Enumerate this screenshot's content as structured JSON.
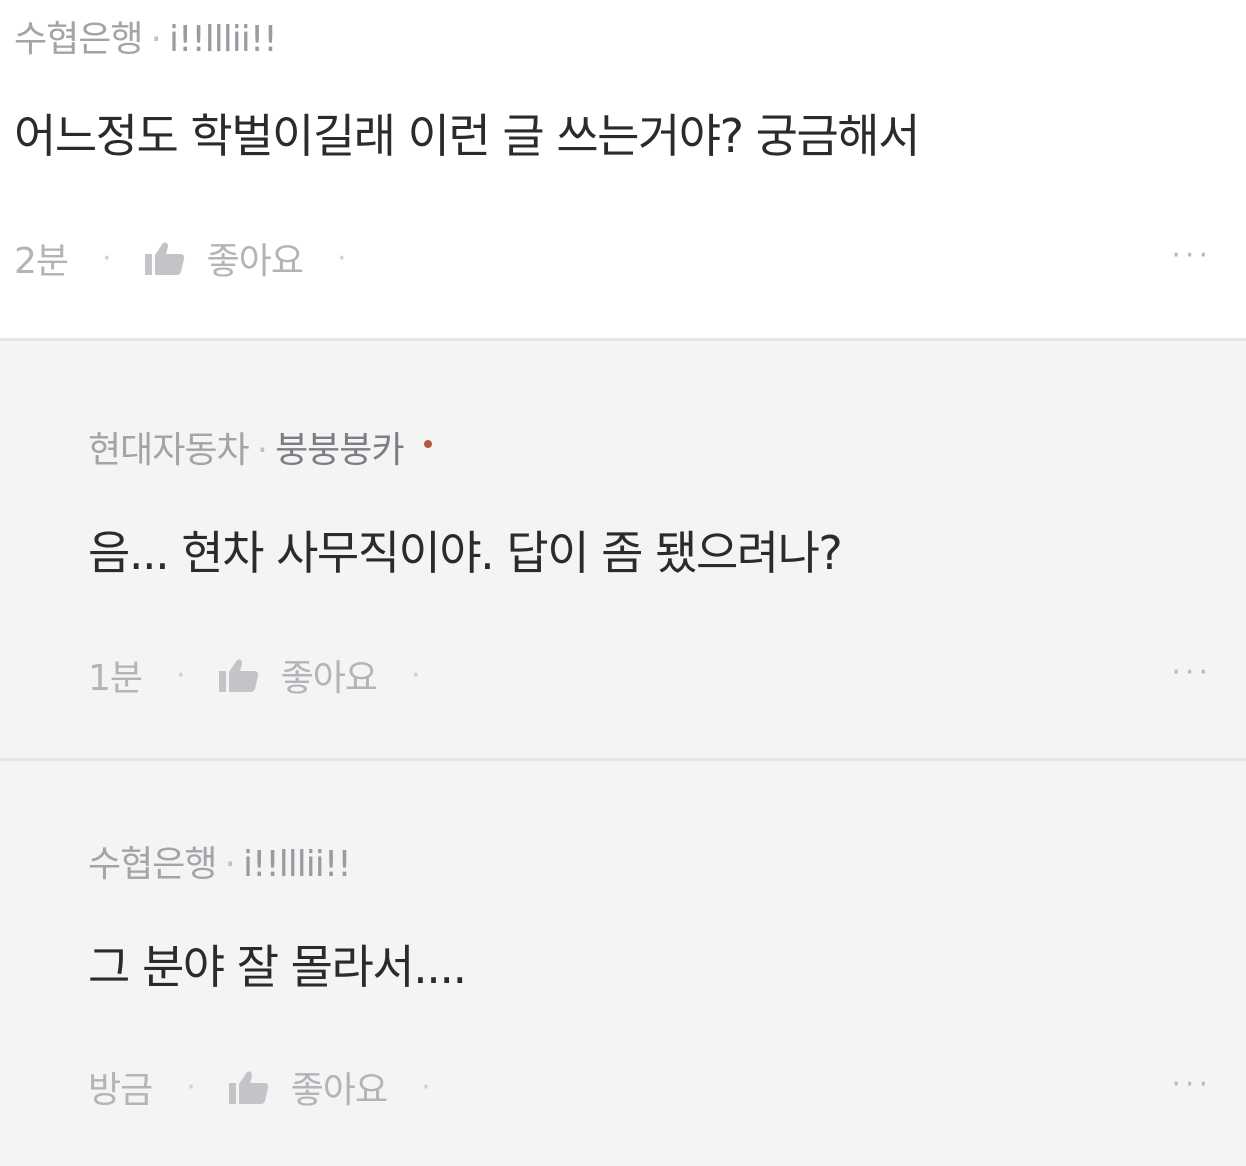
{
  "comments": [
    {
      "company": "수협은행",
      "separator": "·",
      "nickname": "i!!lllii!!",
      "text": "어느정도 학벌이길래 이런 글 쓰는거야? 궁금해서",
      "time": "2분",
      "like_label": "좋아요",
      "more_label": "···"
    },
    {
      "company": "현대자동차",
      "separator": "·",
      "nickname": "붕붕붕카",
      "text": "음... 현차 사무직이야. 답이 좀 됐으려나?",
      "time": "1분",
      "like_label": "좋아요",
      "more_label": "···"
    },
    {
      "company": "수협은행",
      "separator": "·",
      "nickname": "i!!lllii!!",
      "text": "그 분야 잘 몰라서....",
      "time": "방금",
      "like_label": "좋아요",
      "more_label": "···"
    }
  ],
  "colors": {
    "author_dot": "#b65a3c",
    "reply_background": "#f4f4f5",
    "top_background": "#ffffff"
  }
}
